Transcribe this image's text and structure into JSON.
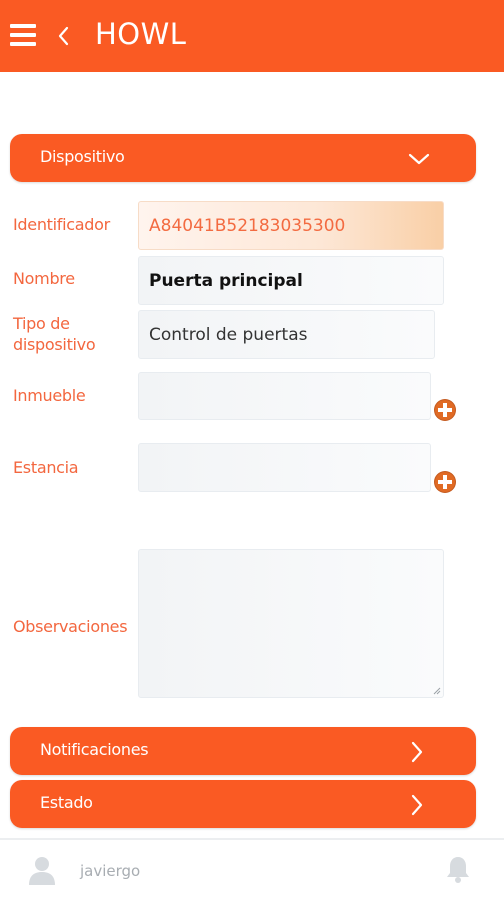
{
  "header": {
    "title": "HOWL",
    "color": "#fa5a23"
  },
  "sections": {
    "dispositivo": "Dispositivo",
    "notificaciones": "Notificaciones",
    "estado": "Estado"
  },
  "form": {
    "identificador": {
      "label": "Identificador",
      "value": "A84041B52183035300"
    },
    "nombre": {
      "label": "Nombre",
      "value": "Puerta principal"
    },
    "tipo": {
      "label": "Tipo de dispositivo",
      "label_line1": "Tipo de",
      "label_line2": "dispositivo",
      "value": "Control de puertas"
    },
    "inmueble": {
      "label": "Inmueble",
      "value": ""
    },
    "estancia": {
      "label": "Estancia",
      "value": ""
    },
    "observaciones": {
      "label": "Observaciones",
      "value": ""
    }
  },
  "footer": {
    "username": "javiergo"
  },
  "icons": [
    "menu-icon",
    "back-icon",
    "chevron-down-icon",
    "chevron-right-icon",
    "plus-icon",
    "avatar",
    "bell-icon"
  ]
}
